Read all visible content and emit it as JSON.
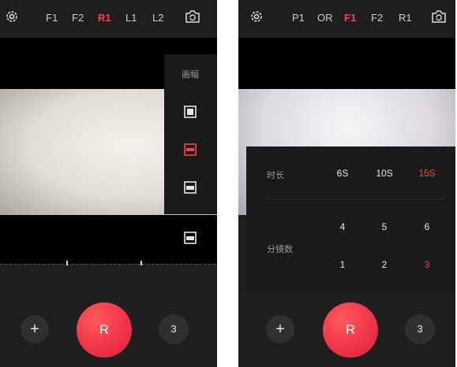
{
  "left_phone": {
    "tabs": [
      {
        "label": "F1",
        "active": false
      },
      {
        "label": "F2",
        "active": false
      },
      {
        "label": "R1",
        "active": true
      },
      {
        "label": "L1",
        "active": false
      },
      {
        "label": "L2",
        "active": false
      }
    ],
    "frame_panel": {
      "title": "画幅",
      "options": [
        {
          "icon": "square-frame-icon",
          "active": false
        },
        {
          "icon": "wide-frame-icon",
          "active": true
        },
        {
          "icon": "cinema-frame-icon",
          "active": false
        },
        {
          "icon": "cinema-frame-icon",
          "active": false
        }
      ]
    },
    "controls": {
      "plus": "+",
      "record": "R",
      "count": "3"
    }
  },
  "right_phone": {
    "tabs": [
      {
        "label": "P1",
        "active": false
      },
      {
        "label": "OR",
        "active": false
      },
      {
        "label": "F1",
        "active": true
      },
      {
        "label": "F2",
        "active": false
      },
      {
        "label": "R1",
        "active": false
      }
    ],
    "duration_panel": {
      "duration_label": "时长",
      "durations": [
        {
          "label": "6S",
          "active": false
        },
        {
          "label": "10S",
          "active": false
        },
        {
          "label": "15S",
          "active": true
        }
      ],
      "shots_label": "分镜数",
      "shots": [
        {
          "label": "4",
          "active": false
        },
        {
          "label": "5",
          "active": false
        },
        {
          "label": "6",
          "active": false
        },
        {
          "label": "1",
          "active": false
        },
        {
          "label": "2",
          "active": false
        },
        {
          "label": "3",
          "active": true
        }
      ]
    },
    "controls": {
      "plus": "+",
      "record": "R",
      "count": "3"
    }
  },
  "colors": {
    "accent": "#ff3d4f",
    "background": "#1f1f1f",
    "panel": "#1a1a1a"
  },
  "icons": {
    "settings": "gear-icon",
    "camera_flip": "camera-switch-icon"
  }
}
